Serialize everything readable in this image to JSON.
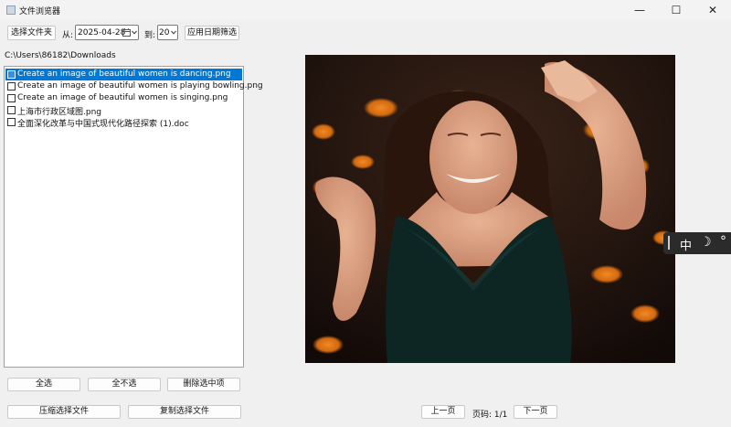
{
  "window": {
    "title": "文件浏览器",
    "minimize_glyph": "—",
    "maximize_glyph": "☐",
    "close_glyph": "✕"
  },
  "toolbar": {
    "choose_folder": "选择文件夹",
    "from_label": "从:",
    "from_date": "2025-04-28",
    "to_label": "到:",
    "to_date": "20",
    "apply_filter": "应用日期筛选"
  },
  "path": "C:\\Users\\86182\\Downloads",
  "files": [
    {
      "name": "Create an image of beautiful women is dancing.png",
      "selected": true
    },
    {
      "name": "Create an image of beautiful women is playing bowling.png",
      "selected": false
    },
    {
      "name": "Create an image of beautiful women is singing.png",
      "selected": false
    },
    {
      "name": "上海市行政区域图.png",
      "selected": false
    },
    {
      "name": "全面深化改革与中国式现代化路径探索 (1).doc",
      "selected": false
    }
  ],
  "actions": {
    "select_all": "全选",
    "select_none": "全不选",
    "delete_selected": "删除选中项",
    "compress": "压缩选择文件",
    "copy": "复制选择文件"
  },
  "pager": {
    "prev": "上一页",
    "page_label": "页码: 1/1",
    "next": "下一页"
  },
  "ime": {
    "mode": "中",
    "moon_icon": "☽",
    "settings_icon": "°"
  },
  "colors": {
    "selection": "#0078d7",
    "photo_dress": "#0d2624",
    "photo_bokeh": "#d36a10"
  }
}
